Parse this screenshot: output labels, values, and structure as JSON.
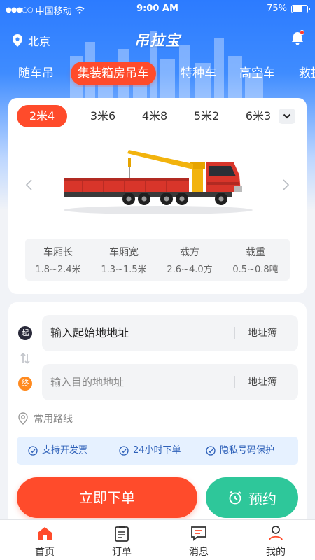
{
  "status_bar": {
    "carrier": "中国移动",
    "time": "9:00 AM",
    "battery": "75%",
    "battery_level": 0.75
  },
  "header": {
    "location": "北京",
    "brand": "吊拉宝"
  },
  "categories": [
    {
      "label": "随车吊"
    },
    {
      "label": "集装箱房吊车",
      "active": true
    },
    {
      "label": "特种车"
    },
    {
      "label": "高空车"
    },
    {
      "label": "救援"
    }
  ],
  "vehicle": {
    "sizes": [
      {
        "label": "2米4",
        "active": true
      },
      {
        "label": "3米6"
      },
      {
        "label": "4米8"
      },
      {
        "label": "5米2"
      },
      {
        "label": "6米3"
      }
    ],
    "specs": [
      {
        "title": "车厢长",
        "value": "1.8~2.4米"
      },
      {
        "title": "车厢宽",
        "value": "1.3~1.5米"
      },
      {
        "title": "载方",
        "value": "2.6~4.0方"
      },
      {
        "title": "载重",
        "value": "0.5~0.8吨"
      }
    ]
  },
  "address": {
    "start_badge": "起",
    "end_badge": "终",
    "start_value": "输入起始地地址",
    "end_placeholder": "输入目的地地址",
    "address_book": "地址簿",
    "common_routes": "常用路线"
  },
  "features": [
    "支持开发票",
    "24小时下单",
    "隐私号码保护"
  ],
  "actions": {
    "order_now": "立即下单",
    "reserve": "预约"
  },
  "tabbar": [
    {
      "label": "首页",
      "icon": "home-icon",
      "active": true
    },
    {
      "label": "订单",
      "icon": "order-icon"
    },
    {
      "label": "消息",
      "icon": "message-icon"
    },
    {
      "label": "我的",
      "icon": "profile-icon"
    }
  ],
  "colors": {
    "accent": "#ff4b2b",
    "brand_blue": "#2c7bff",
    "reserve_green": "#2ec79a",
    "feature_blue": "#2c5fb8"
  }
}
